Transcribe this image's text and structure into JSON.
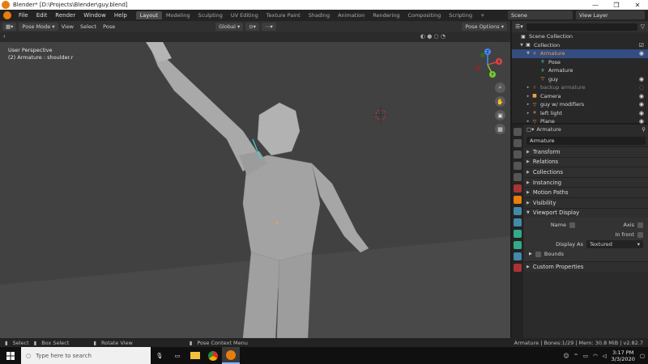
{
  "window": {
    "title": "Blender* [D:\\Projects\\Blender\\guy.blend]",
    "controls": [
      "—",
      "❐",
      "✕"
    ]
  },
  "menu": [
    "File",
    "Edit",
    "Render",
    "Window",
    "Help"
  ],
  "workspaces": [
    {
      "label": "Layout",
      "active": true
    },
    {
      "label": "Modeling"
    },
    {
      "label": "Sculpting"
    },
    {
      "label": "UV Editing"
    },
    {
      "label": "Texture Paint"
    },
    {
      "label": "Shading"
    },
    {
      "label": "Animation"
    },
    {
      "label": "Rendering"
    },
    {
      "label": "Compositing"
    },
    {
      "label": "Scripting"
    }
  ],
  "topright": {
    "scene": "Scene",
    "view_layer": "View Layer"
  },
  "viewport_header": {
    "mode": "Pose Mode",
    "items": [
      "View",
      "Select",
      "Pose"
    ],
    "transform": "Global",
    "pose_options": "Pose Options"
  },
  "viewport": {
    "perspective": "User Perspective",
    "selection": "(2) Armature : shoulder.r",
    "axes": {
      "x": "X",
      "y": "Y",
      "z": "Z"
    }
  },
  "outliner": {
    "rows": [
      {
        "label": "Scene Collection",
        "indent": 0,
        "icon": "collection-icon"
      },
      {
        "label": "Collection",
        "indent": 1,
        "icon": "collection-icon"
      },
      {
        "label": "Armature",
        "indent": 2,
        "icon": "armature-icon",
        "highlight": true
      },
      {
        "label": "Pose",
        "indent": 3,
        "icon": "pose-icon"
      },
      {
        "label": "Armature",
        "indent": 3,
        "icon": "armature-data-icon"
      },
      {
        "label": "guy",
        "indent": 3,
        "icon": "mesh-icon"
      },
      {
        "label": "backup armature",
        "indent": 2,
        "icon": "armature-icon",
        "dim": true
      },
      {
        "label": "Camera",
        "indent": 2,
        "icon": "camera-icon"
      },
      {
        "label": "guy w/ modifiers",
        "indent": 2,
        "icon": "mesh-icon"
      },
      {
        "label": "left light",
        "indent": 2,
        "icon": "light-icon"
      },
      {
        "label": "Plane",
        "indent": 2,
        "icon": "mesh-icon"
      }
    ]
  },
  "properties": {
    "header": "Armature",
    "name_field": "Armature",
    "panels": [
      "Transform",
      "Relations",
      "Collections",
      "Instancing",
      "Motion Paths",
      "Visibility"
    ],
    "viewport_display": {
      "title": "Viewport Display",
      "name_label": "Name",
      "axis_label": "Axis",
      "in_front_label": "In front",
      "display_as_label": "Display As",
      "display_as_value": "Textured",
      "bounds_label": "Bounds"
    },
    "custom_properties": "Custom Properties"
  },
  "statusbar": {
    "items": [
      "Select",
      "Box Select",
      "Rotate View",
      "Pose Context Menu"
    ],
    "stats": "Armature | Bones:1/29 | Mem: 30.8 MiB | v2.82.7"
  },
  "taskbar": {
    "search_placeholder": "Type here to search",
    "time": "3:17 PM",
    "date": "3/3/2020"
  },
  "colors": {
    "accent": "#e87d0d",
    "highlight": "#334d80",
    "viewport": "#414141"
  }
}
